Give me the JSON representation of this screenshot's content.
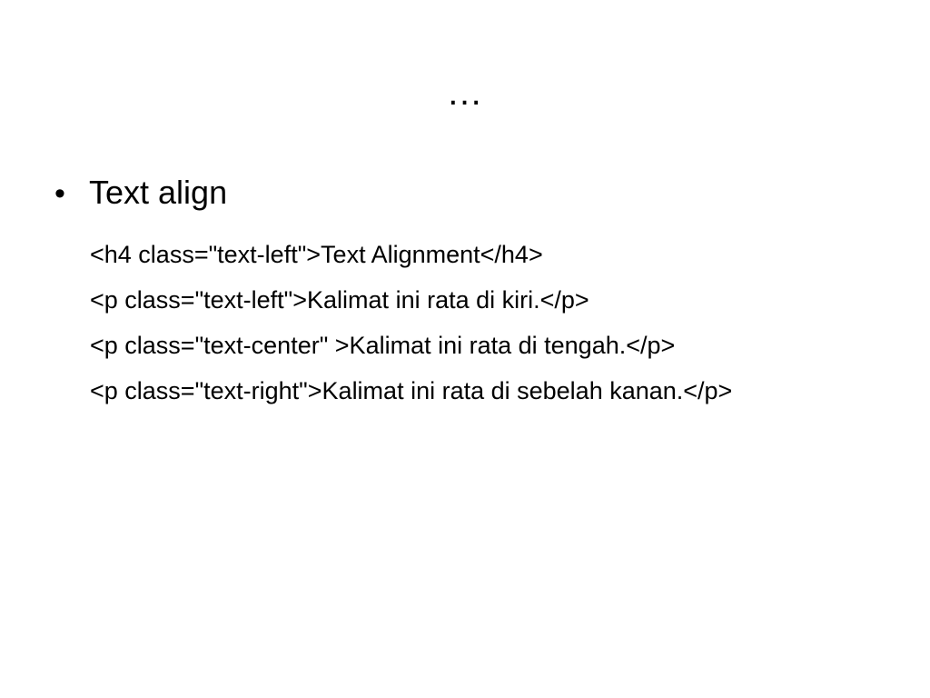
{
  "slide": {
    "title": "…",
    "bullets": [
      {
        "marker": "•",
        "label": "Text align"
      }
    ],
    "code_lines": [
      "<h4 class=\"text-left\">Text Alignment</h4>",
      "<p class=\"text-left\">Kalimat ini rata di kiri.</p>",
      "<p class=\"text-center\" >Kalimat ini rata di tengah.</p>",
      "<p class=\"text-right\">Kalimat ini rata di sebelah kanan.</p>"
    ],
    "colors": {
      "background": "#ffffff",
      "text": "#000000"
    }
  }
}
